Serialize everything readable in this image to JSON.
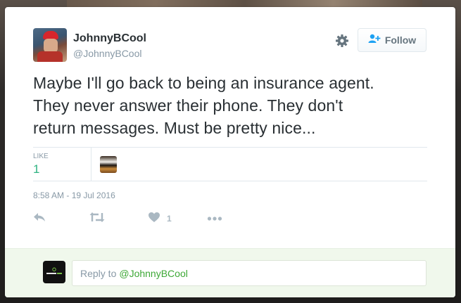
{
  "user": {
    "display_name": "JohnnyBCool",
    "username": "@JohnnyBCool"
  },
  "follow_button": {
    "label": "Follow",
    "icon": "add-user-icon"
  },
  "settings_icon": "gear-icon",
  "tweet": {
    "text": "Maybe I'll go back to being an insurance agent.\nThey never answer their phone. They don't\nreturn messages. Must be pretty nice..."
  },
  "stats": {
    "like_label": "LIKE",
    "like_count": "1"
  },
  "timestamp": "8:58 AM - 19 Jul 2016",
  "actions": {
    "reply_icon": "reply-icon",
    "retweet_icon": "retweet-icon",
    "like_icon": "heart-icon",
    "like_count": "1",
    "more_icon": "more-icon"
  },
  "reply": {
    "prefix": "Reply to",
    "mention": "@JohnnyBCool"
  },
  "colors": {
    "like_green": "#2fb381",
    "mention_green": "#3da836",
    "reply_bar_bg": "#f0f8ec",
    "text_primary": "#292f33",
    "text_secondary": "#8899a6"
  }
}
